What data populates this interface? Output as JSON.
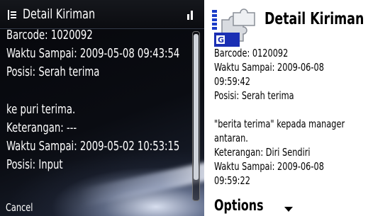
{
  "left": {
    "title": "Detail Kiriman",
    "lines": [
      "Barcode: 1020092",
      "Waktu Sampai: 2009-05-08 09:43:54",
      "Posisi: Serah terima",
      "ke puri terima.",
      "Keterangan: ---",
      "Waktu Sampai: 2009-05-02 10:53:15",
      "Posisi: Input"
    ],
    "softkey_left": "Cancel",
    "scroll_position": 0.0
  },
  "right": {
    "title": "Detail Kiriman",
    "lines": [
      "Barcode: 0120092",
      "Waktu Sampai: 2009-06-08",
      "09:59:42",
      "Posisi: Serah terima",
      "\"berita terima\" kepada manager",
      "antaran.",
      "Keterangan: Diri Sendiri",
      "Waktu Sampai: 2009-06-08",
      "09:59:22"
    ],
    "softkey_left": "Options"
  }
}
